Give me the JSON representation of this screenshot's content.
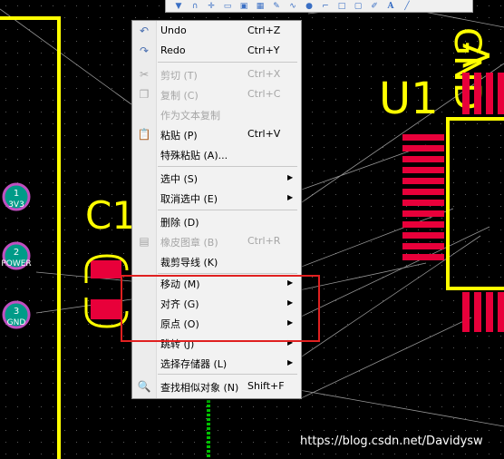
{
  "canvas": {
    "component_labels": {
      "c1": "C1",
      "u1": "U1",
      "gnd_partial": "GND",
      "v_partial": "V"
    },
    "pins": [
      {
        "number": "1",
        "net": "3V3"
      },
      {
        "number": "2",
        "net": "POWER"
      },
      {
        "number": "3",
        "net": "GND"
      }
    ]
  },
  "toolbar": {
    "icons": [
      "filter-icon",
      "magnet-icon",
      "move-cross-icon",
      "select-rect-icon",
      "component-icon",
      "chip-icon",
      "pencil-icon",
      "wave-icon",
      "pin-icon",
      "route-icon",
      "rect-icon",
      "rect2-icon",
      "edit-icon",
      "text-icon",
      "line-icon"
    ],
    "text_glyph": "A"
  },
  "context_menu": {
    "items": [
      {
        "label": "Undo",
        "shortcut": "Ctrl+Z",
        "icon": "undo-icon",
        "enabled": true,
        "submenu": false
      },
      {
        "label": "Redo",
        "shortcut": "Ctrl+Y",
        "icon": "redo-icon",
        "enabled": true,
        "submenu": false
      },
      {
        "label": "剪切 (T)",
        "shortcut": "Ctrl+X",
        "icon": "scissors-icon",
        "enabled": false,
        "submenu": false
      },
      {
        "label": "复制 (C)",
        "shortcut": "Ctrl+C",
        "icon": "copy-icon",
        "enabled": false,
        "submenu": false
      },
      {
        "label": "作为文本复制",
        "shortcut": "",
        "icon": "",
        "enabled": false,
        "submenu": false
      },
      {
        "label": "粘贴 (P)",
        "shortcut": "Ctrl+V",
        "icon": "paste-icon",
        "enabled": true,
        "submenu": false
      },
      {
        "label": "特殊粘贴 (A)...",
        "shortcut": "",
        "icon": "",
        "enabled": true,
        "submenu": false
      },
      {
        "label": "选中 (S)",
        "shortcut": "",
        "icon": "",
        "enabled": true,
        "submenu": true
      },
      {
        "label": "取消选中 (E)",
        "shortcut": "",
        "icon": "",
        "enabled": true,
        "submenu": true
      },
      {
        "label": "删除 (D)",
        "shortcut": "",
        "icon": "",
        "enabled": true,
        "submenu": false
      },
      {
        "label": "橡皮图章 (B)",
        "shortcut": "Ctrl+R",
        "icon": "stamp-icon",
        "enabled": false,
        "submenu": false
      },
      {
        "label": "裁剪导线 (K)",
        "shortcut": "",
        "icon": "",
        "enabled": true,
        "submenu": false
      },
      {
        "label": "移动 (M)",
        "shortcut": "",
        "icon": "",
        "enabled": true,
        "submenu": true
      },
      {
        "label": "对齐 (G)",
        "shortcut": "",
        "icon": "",
        "enabled": true,
        "submenu": true
      },
      {
        "label": "原点 (O)",
        "shortcut": "",
        "icon": "",
        "enabled": true,
        "submenu": true
      },
      {
        "label": "跳转 (J)",
        "shortcut": "",
        "icon": "",
        "enabled": true,
        "submenu": true
      },
      {
        "label": "选择存储器 (L)",
        "shortcut": "",
        "icon": "",
        "enabled": true,
        "submenu": true
      },
      {
        "label": "查找相似对象 (N)",
        "shortcut": "Shift+F",
        "icon": "find-similar-icon",
        "enabled": true,
        "submenu": false
      }
    ]
  },
  "watermark": "https://blog.csdn.net/Davidysw",
  "colors": {
    "highlight_box": "#e02020",
    "silkscreen": "#ffff00",
    "pad": "#e8003a",
    "via": "#009b88"
  }
}
